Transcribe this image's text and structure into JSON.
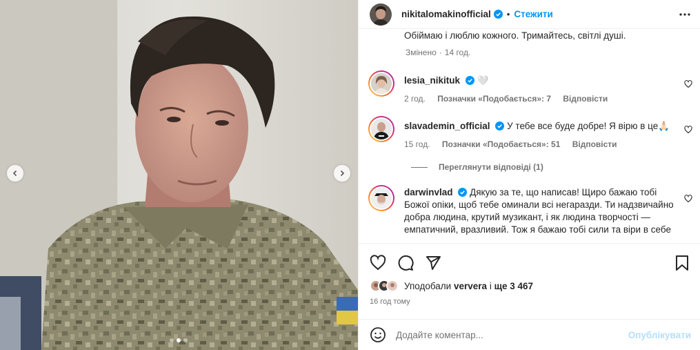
{
  "header": {
    "username": "nikitalomakinofficial",
    "separator": "•",
    "follow_label": "Стежити"
  },
  "caption": {
    "text_tail": "Обіймаю і люблю кожного. Тримайтесь, світлі душі.",
    "edited": "Змінено",
    "time": "14 год."
  },
  "comments": [
    {
      "username": "lesia_nikituk",
      "text": "🤍",
      "time": "2 год.",
      "likes": "Позначки «Подобається»: 7",
      "reply": "Відповісти"
    },
    {
      "username": "slavademin_official",
      "text": "У тебе все буде добре! Я вірю в це🙏🏻",
      "time": "15 год.",
      "likes": "Позначки «Подобається»: 51",
      "reply": "Відповісти"
    },
    {
      "username": "darwinvlad",
      "text": "Дякую за те, що написав! Щиро бажаю тобі Божої опіки, щоб тебе оминали всі негаразди. Ти надзвичайно добра людина, крутий музикант, і як людина творчості — емпатичний, вразливий. Тож я бажаю тобі сили та віри в себе"
    }
  ],
  "view_replies": "Переглянути відповіді (1)",
  "likes": {
    "prefix": "Уподобали",
    "user": "ververa",
    "connector": "і",
    "rest": "ще 3 467"
  },
  "post_time": "16 год тому",
  "add_comment": {
    "placeholder": "Додайте коментар...",
    "publish_label": "Опублікувати"
  },
  "media": {
    "slides": 3,
    "current_slide": 2
  },
  "colors": {
    "accent": "#0095f6",
    "muted": "#737373",
    "publish_disabled": "#b2dffc",
    "verified": "#0095f6"
  },
  "icons": [
    "chevron-left-icon",
    "chevron-right-icon",
    "more-icon",
    "verified-icon",
    "heart-icon",
    "comment-icon",
    "share-icon",
    "bookmark-icon",
    "emoji-icon"
  ]
}
